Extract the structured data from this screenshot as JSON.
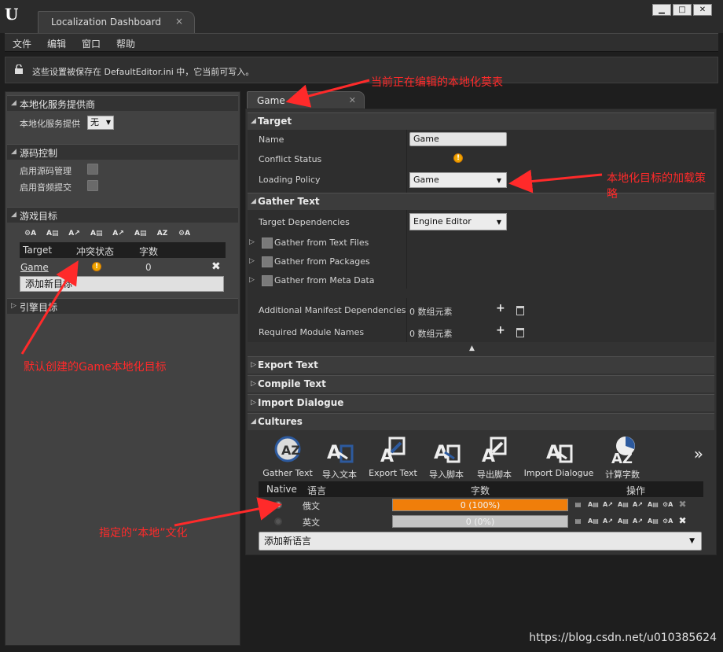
{
  "window": {
    "tab_title": "Localization Dashboard",
    "tab_close": "×",
    "controls": [
      "▁",
      "□",
      "✕"
    ]
  },
  "menu": [
    "文件",
    "编辑",
    "窗口",
    "帮助"
  ],
  "info_bar": {
    "text": "这些设置被保存在 DefaultEditor.ini 中，它当前可写入。"
  },
  "left": {
    "providers": {
      "title": "本地化服务提供商",
      "label": "本地化服务提供",
      "value": "无"
    },
    "source_control": {
      "title": "源码控制",
      "enable_scc": "启用源码管理",
      "enable_auto": "启用音频提交"
    },
    "game_targets": {
      "title": "游戏目标",
      "headers": [
        "Target",
        "冲突状态",
        "字数"
      ],
      "row": {
        "name": "Game",
        "count": "0"
      },
      "add_button": "添加新目标"
    },
    "engine_targets": {
      "title": "引擎目标"
    }
  },
  "right": {
    "tab": "Game",
    "target": {
      "title": "Target",
      "name_label": "Name",
      "name_value": "Game",
      "conflict_label": "Conflict Status",
      "loading_label": "Loading Policy",
      "loading_value": "Game"
    },
    "gather": {
      "title": "Gather Text",
      "deps_label": "Target Dependencies",
      "deps_value": "Engine     Editor",
      "from_text": "Gather from Text Files",
      "from_packages": "Gather from Packages",
      "from_meta": "Gather from Meta Data",
      "manifest_label": "Additional Manifest Dependencies",
      "manifest_value": "0 数组元素",
      "modules_label": "Required Module Names",
      "modules_value": "0 数组元素"
    },
    "sections": [
      "Export Text",
      "Compile Text",
      "Import Dialogue"
    ],
    "cultures": {
      "title": "Cultures",
      "tools": [
        "Gather Text",
        "导入文本",
        "Export Text",
        "导入脚本",
        "导出脚本",
        "Import Dialogue",
        "计算字数"
      ],
      "headers": [
        "Native",
        "语言",
        "字数",
        "操作"
      ],
      "rows": [
        {
          "lang": "俄文",
          "progress": 1.0,
          "text": "0 (100%)"
        },
        {
          "lang": "英文",
          "progress": 0.0,
          "text": "0 (0%)"
        }
      ],
      "add_button": "添加新语言"
    }
  },
  "annotations": {
    "current_table": "当前正在编辑的本地化莫表",
    "loading_policy": "本地化目标的加载策",
    "loading_policy_2": "略",
    "default_target": "默认创建的Game本地化目标",
    "native_culture": "指定的“本地”文化"
  },
  "watermark": "https://blog.csdn.net/u010385624",
  "colors": {
    "progress": "#f07e0a",
    "annotation": "#ff2a2a",
    "warning": "#f0a500"
  }
}
